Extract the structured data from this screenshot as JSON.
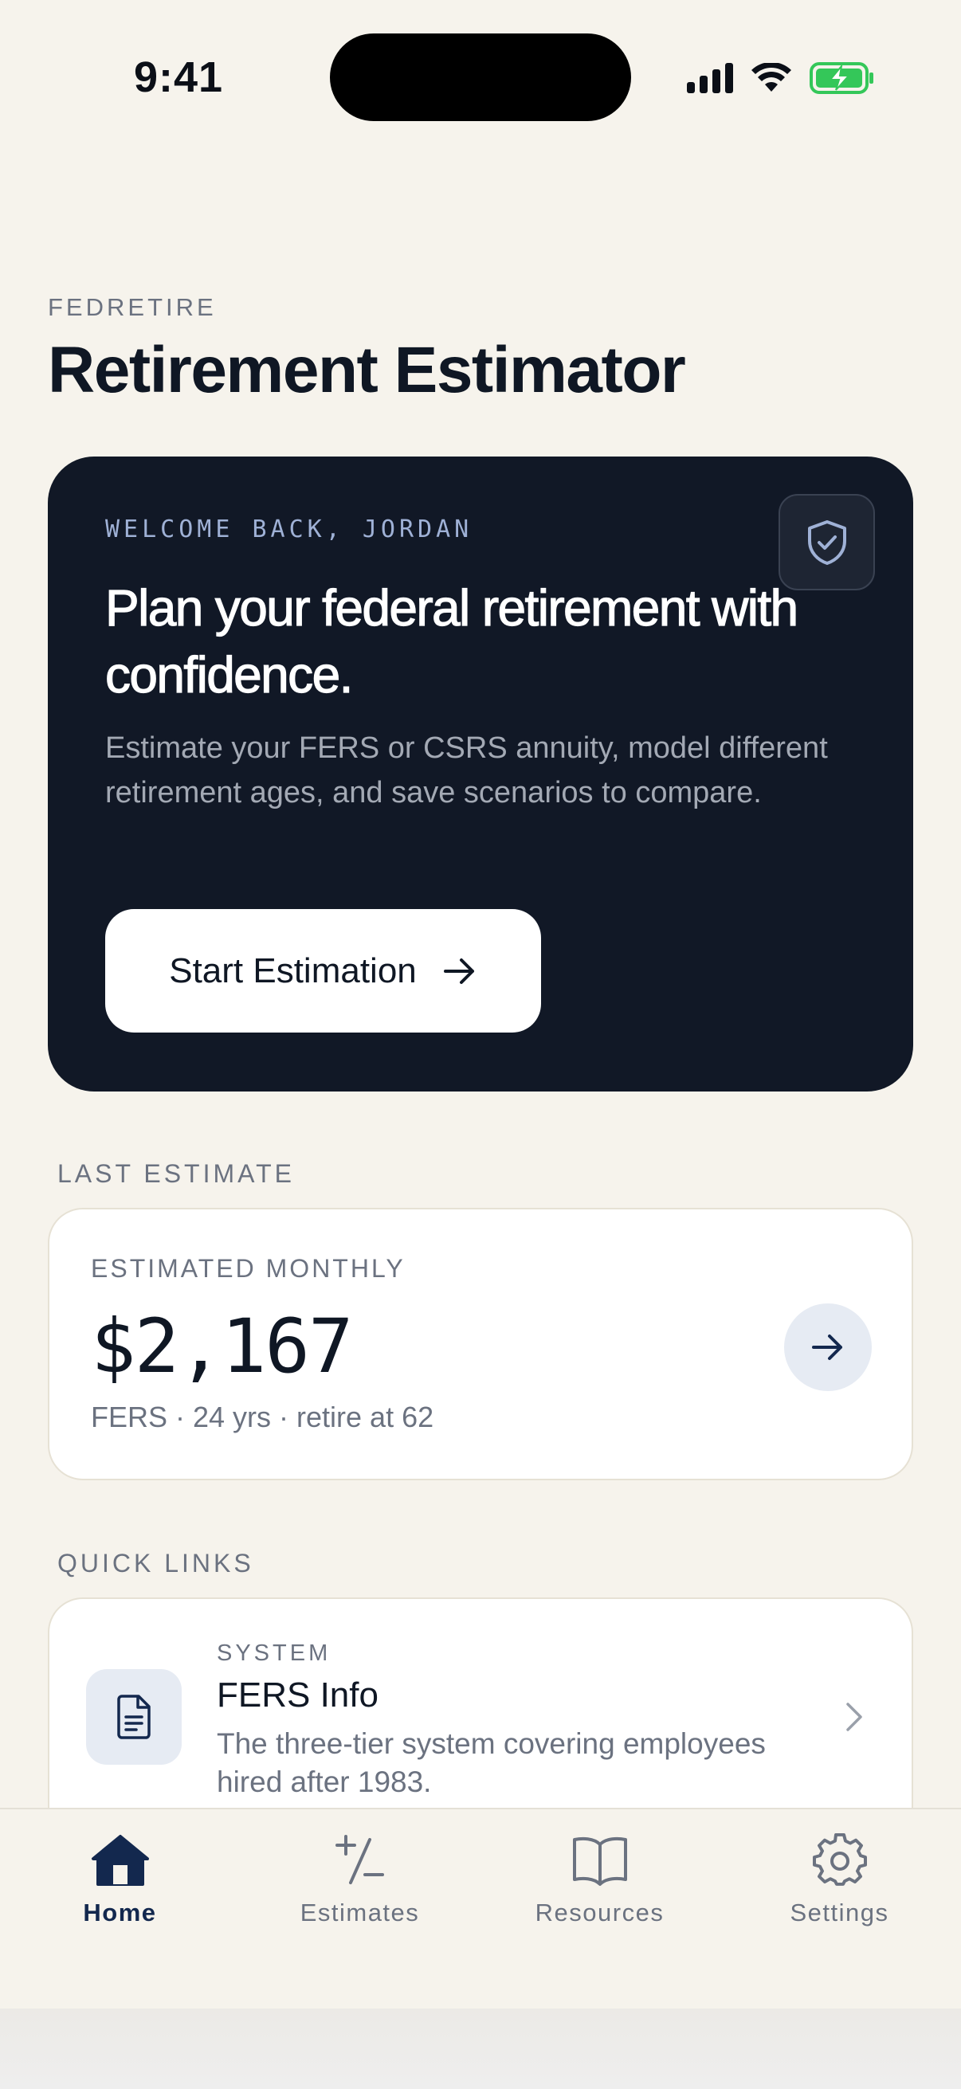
{
  "status_bar": {
    "time": "9:41"
  },
  "header": {
    "app_name": "FEDRETIRE",
    "title": "Retirement Estimator"
  },
  "hero": {
    "kicker": "WELCOME BACK, JORDAN",
    "heading": "Plan your federal retirement with confidence.",
    "description": "Estimate your FERS or CSRS annuity, model different retirement ages, and save scenarios to compare.",
    "cta_label": "Start Estimation",
    "badge_icon": "shield-check-icon"
  },
  "last_estimate": {
    "section_label": "LAST ESTIMATE",
    "kicker": "ESTIMATED MONTHLY",
    "value": "$2,167",
    "meta": "FERS · 24 yrs · retire at 62"
  },
  "quick_links": {
    "section_label": "QUICK LINKS",
    "items": [
      {
        "kicker": "SYSTEM",
        "title": "FERS Info",
        "description": "The three-tier system covering employees hired after 1983.",
        "icon": "document-icon"
      }
    ]
  },
  "tab_bar": {
    "tabs": [
      {
        "label": "Home",
        "icon": "home-icon",
        "active": true
      },
      {
        "label": "Estimates",
        "icon": "plus-minus-icon",
        "active": false
      },
      {
        "label": "Resources",
        "icon": "book-icon",
        "active": false
      },
      {
        "label": "Settings",
        "icon": "gear-icon",
        "active": false
      }
    ]
  },
  "colors": {
    "background": "#f6f3ec",
    "hero_background": "#111826",
    "accent_navy": "#13284e",
    "muted_text": "#6b7280",
    "battery_green": "#34c759"
  }
}
